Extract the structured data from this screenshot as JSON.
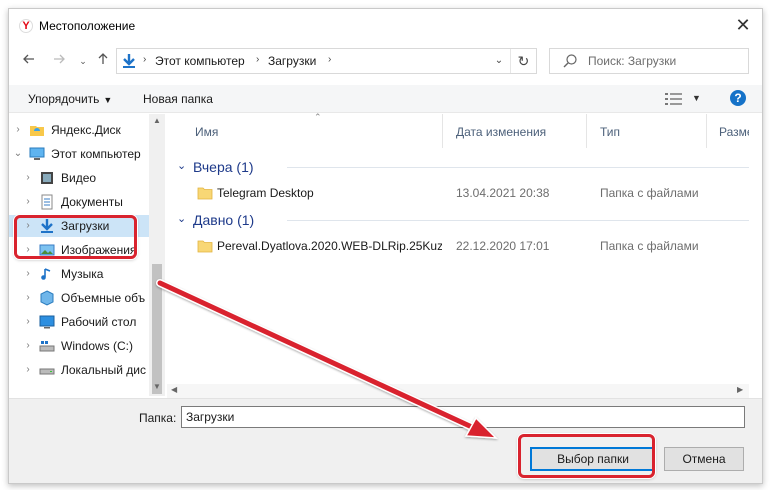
{
  "window": {
    "title": "Местоположение",
    "close_symbol": "✕",
    "logo_letter": "Y"
  },
  "nav": {
    "back_icon": "back-arrow-icon",
    "forward_icon": "forward-arrow-icon",
    "recent_icon": "chevron-down-icon",
    "up_icon": "up-arrow-icon",
    "breadcrumb": [
      "Этот компьютер",
      "Загрузки"
    ],
    "refresh_icon": "refresh-icon",
    "search_placeholder": "Поиск: Загрузки"
  },
  "command_bar": {
    "organize_label": "Упорядочить",
    "new_folder_label": "Новая папка",
    "help_label": "?"
  },
  "tree": [
    {
      "label": "Яндекс.Диск",
      "icon": "yandex-disk-icon",
      "chevron": "›",
      "indent": 0,
      "selected": false
    },
    {
      "label": "Этот компьютер",
      "icon": "computer-icon",
      "chevron": "⌄",
      "indent": 0,
      "selected": false
    },
    {
      "label": "Видео",
      "icon": "video-folder-icon",
      "chevron": "›",
      "indent": 1,
      "selected": false
    },
    {
      "label": "Документы",
      "icon": "documents-folder-icon",
      "chevron": "›",
      "indent": 1,
      "selected": false
    },
    {
      "label": "Загрузки",
      "icon": "downloads-folder-icon",
      "chevron": "›",
      "indent": 1,
      "selected": true
    },
    {
      "label": "Изображения",
      "icon": "pictures-folder-icon",
      "chevron": "›",
      "indent": 1,
      "selected": false
    },
    {
      "label": "Музыка",
      "icon": "music-folder-icon",
      "chevron": "›",
      "indent": 1,
      "selected": false
    },
    {
      "label": "Объемные объ",
      "icon": "3d-objects-icon",
      "chevron": "›",
      "indent": 1,
      "selected": false
    },
    {
      "label": "Рабочий стол",
      "icon": "desktop-folder-icon",
      "chevron": "›",
      "indent": 1,
      "selected": false
    },
    {
      "label": "Windows (C:)",
      "icon": "system-drive-icon",
      "chevron": "›",
      "indent": 1,
      "selected": false
    },
    {
      "label": "Локальный дис",
      "icon": "local-drive-icon",
      "chevron": "›",
      "indent": 1,
      "selected": false
    }
  ],
  "columns": {
    "name": "Имя",
    "date": "Дата изменения",
    "type": "Тип",
    "size": "Размер"
  },
  "groups": [
    {
      "label": "Вчера (1)",
      "items": [
        {
          "name": "Telegram Desktop",
          "date": "13.04.2021 20:38",
          "type": "Папка с файлами"
        }
      ]
    },
    {
      "label": "Давно (1)",
      "items": [
        {
          "name": "Pereval.Dyatlova.2020.WEB-DLRip.25Kuz...",
          "date": "22.12.2020 17:01",
          "type": "Папка с файлами"
        }
      ]
    }
  ],
  "bottom": {
    "folder_label": "Папка:",
    "folder_value": "Загрузки",
    "select_button": "Выбор папки",
    "cancel_button": "Отмена"
  },
  "colors": {
    "annotation": "#d9232e",
    "selection": "#cce4f7",
    "group_text": "#1e3a8a"
  }
}
